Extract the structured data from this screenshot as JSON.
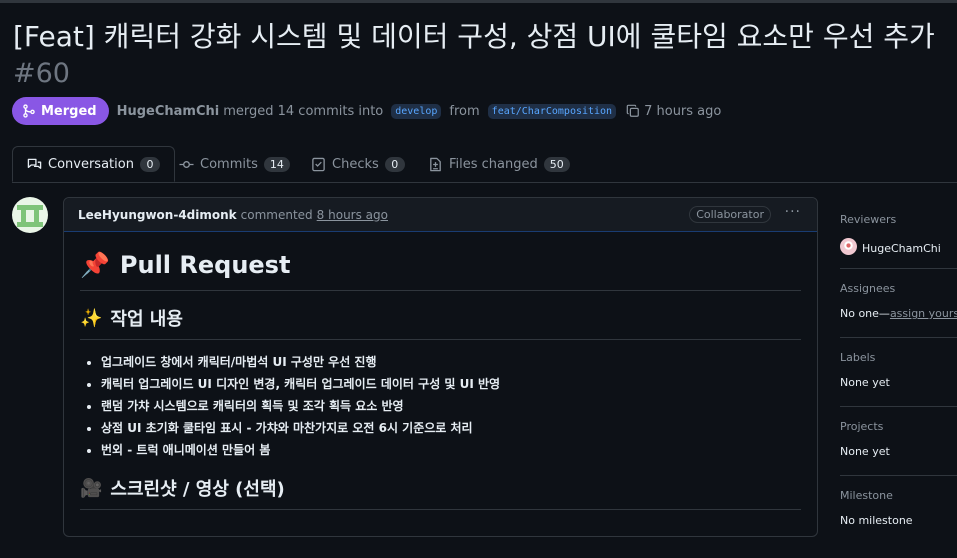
{
  "pr": {
    "title": "[Feat] 캐릭터 강화 시스템 및 데이터 구성, 상점 UI에 쿨타임 요소만 우선 추가",
    "number": "#60",
    "state": "Merged",
    "author": "HugeChamChi",
    "merge_text": "merged 14 commits into",
    "base_branch": "develop",
    "from_text": "from",
    "head_branch": "feat/CharComposition",
    "time": "7 hours ago"
  },
  "tabs": [
    {
      "label": "Conversation",
      "count": "0"
    },
    {
      "label": "Commits",
      "count": "14"
    },
    {
      "label": "Checks",
      "count": "0"
    },
    {
      "label": "Files changed",
      "count": "50"
    }
  ],
  "comment": {
    "author": "LeeHyungwon-4dimonk",
    "action": "commented",
    "time": "8 hours ago",
    "badge": "Collaborator",
    "menu": "···",
    "h1_emoji": "📌",
    "h1": "Pull Request",
    "h2a_emoji": "✨",
    "h2a": "작업 내용",
    "items": [
      "업그레이드 창에서 캐릭터/마법석 UI 구성만 우선 진행",
      "캐릭터 업그레이드 UI 디자인 변경, 캐릭터 업그레이드 데이터 구성 및 UI 반영",
      "랜덤 가챠 시스템으로 캐릭터의 획득 및 조각 획득 요소 반영",
      "상점 UI 초기화 쿨타임 표시 - 가챠와 마찬가지로 오전 6시 기준으로 처리",
      "번외 - 트럭 애니메이션 만들어 봄"
    ],
    "h2b_emoji": "🎥",
    "h2b": "스크린샷 / 영상 (선택)"
  },
  "sidebar": {
    "reviewers_label": "Reviewers",
    "reviewer_name": "HugeChamChi",
    "assignees_label": "Assignees",
    "assignees_value": "No one—",
    "assignees_link": "assign yourself",
    "labels_label": "Labels",
    "labels_value": "None yet",
    "projects_label": "Projects",
    "projects_value": "None yet",
    "milestone_label": "Milestone",
    "milestone_value": "No milestone"
  },
  "colors": {
    "background": "#0d1117",
    "merged": "#8957e5",
    "link": "#58a6ff",
    "border": "#30363d"
  },
  "icons": [
    "merge-icon",
    "copy-icon",
    "conversation-icon",
    "commit-icon",
    "checks-icon",
    "file-diff-icon",
    "kebab-icon"
  ]
}
